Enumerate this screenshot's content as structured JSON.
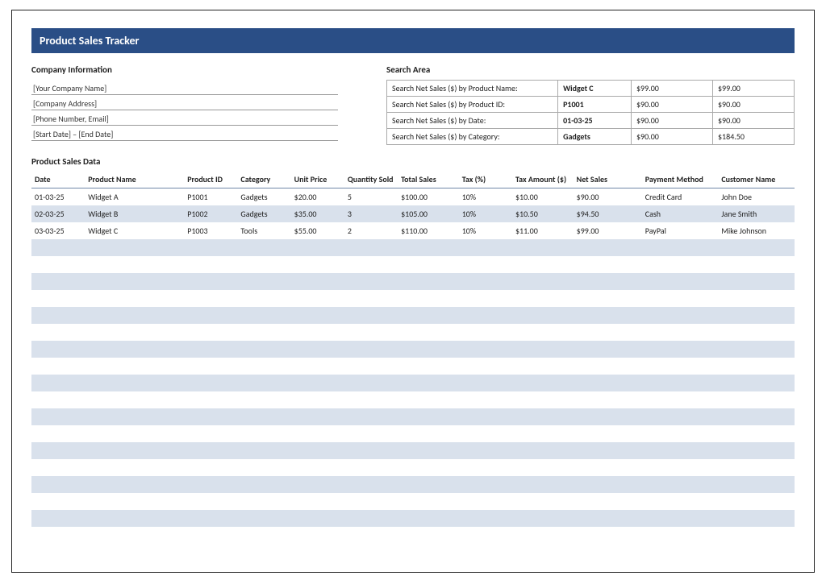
{
  "title": "Product Sales Tracker",
  "company": {
    "heading": "Company Information",
    "lines": [
      "[Your Company Name]",
      "[Company Address]",
      "[Phone Number, Email]",
      "[Start Date] – [End Date]"
    ]
  },
  "search": {
    "heading": "Search Area",
    "rows": [
      {
        "label": "Search Net Sales ($) by Product Name:",
        "key": "Widget C",
        "v1": "$99.00",
        "v2": "$99.00"
      },
      {
        "label": "Search Net Sales ($) by Product ID:",
        "key": "P1001",
        "v1": "$90.00",
        "v2": "$90.00"
      },
      {
        "label": "Search Net Sales ($) by Date:",
        "key": "01-03-25",
        "v1": "$90.00",
        "v2": "$90.00"
      },
      {
        "label": "Search Net Sales ($) by Category:",
        "key": "Gadgets",
        "v1": "$90.00",
        "v2": "$184.50"
      }
    ]
  },
  "sales": {
    "heading": "Product Sales Data",
    "columns": [
      "Date",
      "Product Name",
      "Product ID",
      "Category",
      "Unit Price",
      "Quantity Sold",
      "Total Sales",
      "Tax (%)",
      "Tax Amount ($)",
      "Net Sales",
      "Payment Method",
      "Customer Name"
    ],
    "rows": [
      {
        "date": "01-03-25",
        "pname": "Widget A",
        "pid": "P1001",
        "cat": "Gadgets",
        "price": "$20.00",
        "qty": "5",
        "total": "$100.00",
        "taxp": "10%",
        "taxa": "$10.00",
        "net": "$90.00",
        "pay": "Credit Card",
        "cust": "John Doe"
      },
      {
        "date": "02-03-25",
        "pname": "Widget B",
        "pid": "P1002",
        "cat": "Gadgets",
        "price": "$35.00",
        "qty": "3",
        "total": "$105.00",
        "taxp": "10%",
        "taxa": "$10.50",
        "net": "$94.50",
        "pay": "Cash",
        "cust": "Jane Smith"
      },
      {
        "date": "03-03-25",
        "pname": "Widget C",
        "pid": "P1003",
        "cat": "Tools",
        "price": "$55.00",
        "qty": "2",
        "total": "$110.00",
        "taxp": "10%",
        "taxa": "$11.00",
        "net": "$99.00",
        "pay": "PayPal",
        "cust": "Mike Johnson"
      }
    ],
    "empty_row_count": 17
  }
}
